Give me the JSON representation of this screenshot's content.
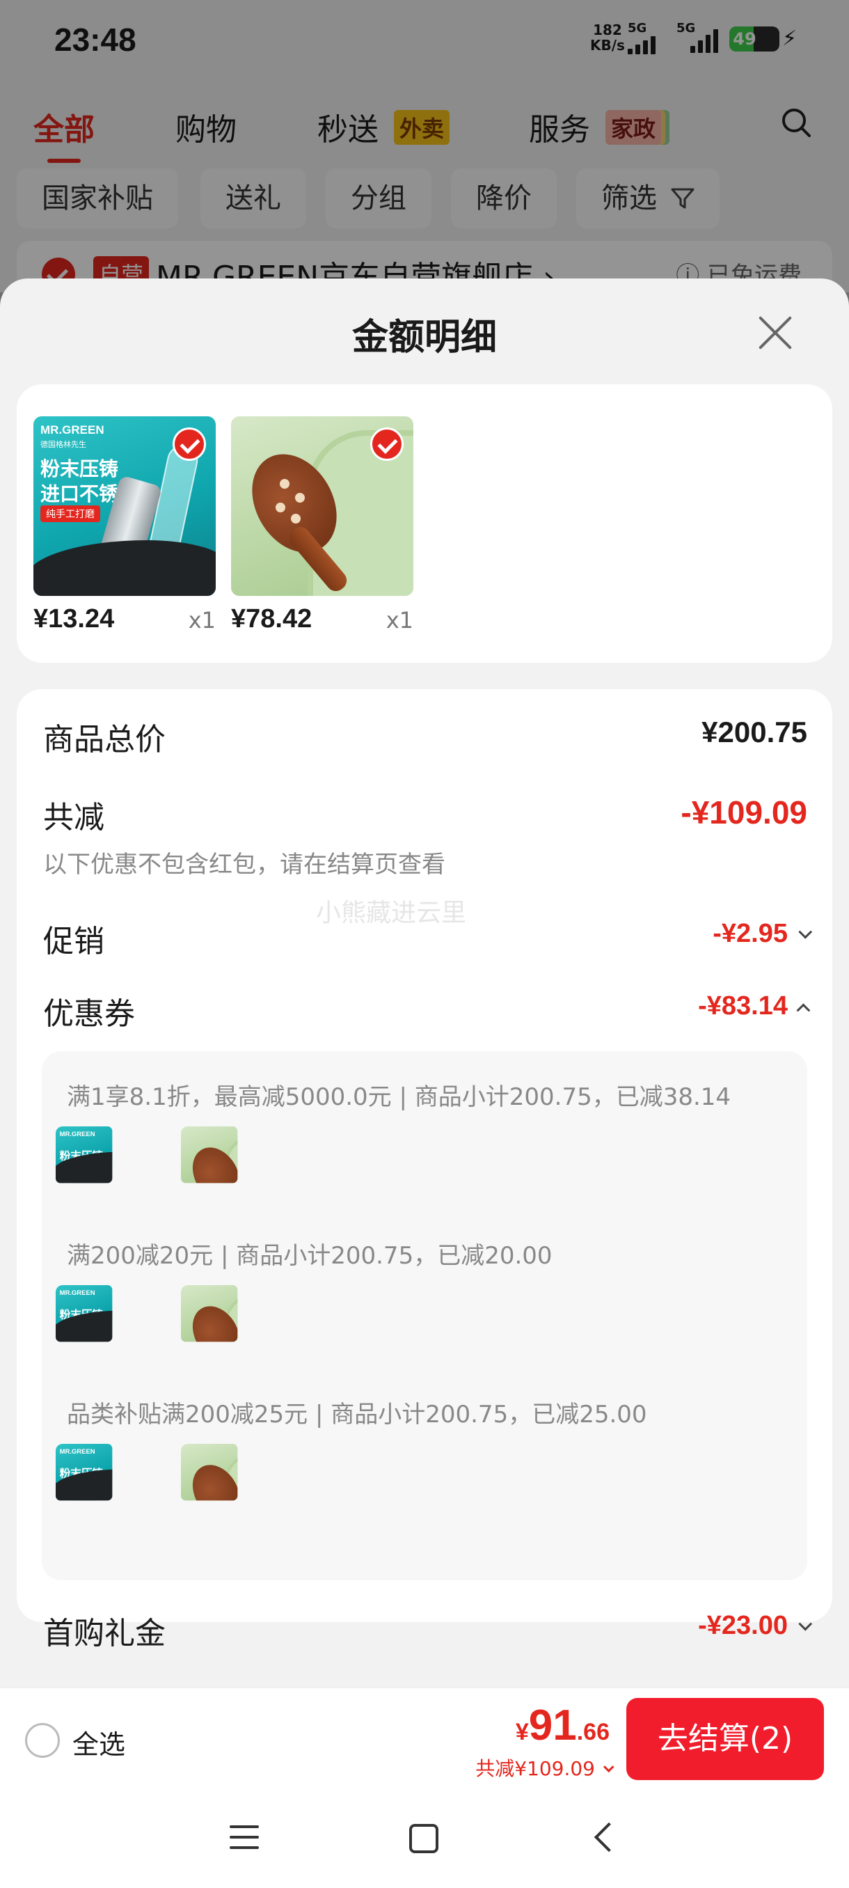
{
  "status_bar": {
    "time": "23:48",
    "net_speed": "182",
    "net_unit": "KB/s",
    "sim1": "5G",
    "sim2": "5G",
    "battery": "49",
    "battery_level": 0.49
  },
  "nav_tabs": [
    {
      "label": "全部",
      "active": true
    },
    {
      "label": "购物"
    },
    {
      "label": "秒送",
      "tag": "外卖"
    },
    {
      "label": "服务",
      "tag": "家政"
    }
  ],
  "filters": [
    "国家补贴",
    "送礼",
    "分组",
    "降价",
    "筛选"
  ],
  "store": {
    "badge": "自营",
    "name": "MR.GREEN京东自营旗舰店 ›",
    "shipping": "ⓘ 已免运费"
  },
  "sheet": {
    "title": "金额明细",
    "products": [
      {
        "price": "¥13.24",
        "qty": "x1",
        "image": "nail-clipper",
        "brand": "MR.GREEN",
        "brand_sub": "德国格林先生",
        "headline": "粉末压铸",
        "headline2": "进口不锈钢",
        "pill": "纯手工打磨"
      },
      {
        "price": "¥78.42",
        "qty": "x1",
        "image": "wooden-comb"
      }
    ],
    "total_label": "商品总价",
    "total_value": "¥200.75",
    "reduce_label": "共减",
    "reduce_value": "-¥109.09",
    "reduce_note": "以下优惠不包含红包，请在结算页查看",
    "watermark": "小熊藏进云里",
    "promo_label": "促销",
    "promo_value": "-¥2.95",
    "coupon_label": "优惠券",
    "coupon_value": "-¥83.14",
    "coupon_lines": [
      "满1享8.1折，最高减5000.0元 | 商品小计200.75，已减38.14",
      "满200减20元 | 商品小计200.75，已减20.00",
      "品类补贴满200减25元 | 商品小计200.75，已减25.00"
    ],
    "gift_label": "首购礼金",
    "gift_value": "-¥23.00"
  },
  "bottom_bar": {
    "select_all": "全选",
    "currency": "¥",
    "total_int": "91",
    "total_dec": ".66",
    "saved": "共减¥109.09",
    "checkout": "去结算(2)"
  },
  "colors": {
    "accent": "#e4271e",
    "checkout": "#f21d2c"
  }
}
